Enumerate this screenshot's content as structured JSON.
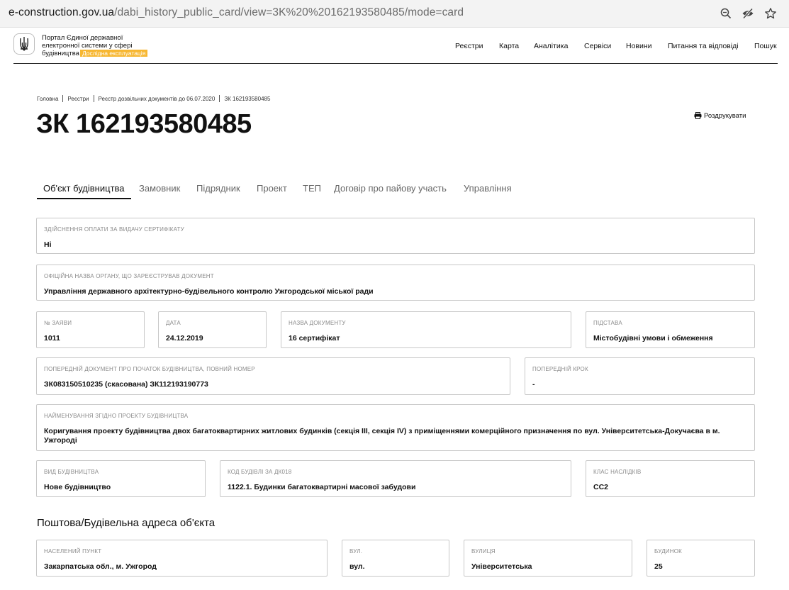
{
  "browser": {
    "url_host": "e-construction.gov.ua",
    "url_path": "/dabi_history_public_card/view=3K%20%20162193580485/mode=card"
  },
  "header": {
    "logo_line1": "Портал Єдиної державної",
    "logo_line2": "електронної системи у сфері",
    "logo_line3": "будівництва",
    "logo_badge": "Дослідна експлуатація",
    "nav": [
      "Реєстри",
      "Карта",
      "Аналітика",
      "Сервіси",
      "Новини",
      "Питання та відповіді",
      "Пошук"
    ]
  },
  "breadcrumb": [
    "Головна",
    "Реєстри",
    "Реєстр дозвільних документів до 06.07.2020",
    "ЗК 162193580485"
  ],
  "page": {
    "title": "ЗК 162193580485",
    "print_label": "Роздрукувати"
  },
  "tabs": [
    "Об'єкт будівництва",
    "Замовник",
    "Підрядник",
    "Проект",
    "ТЕП",
    "Договір про пайову участь",
    "Управління"
  ],
  "fields": {
    "payment": {
      "label": "Здійснення оплати за видачу сертифікату",
      "value": "Ні"
    },
    "authority": {
      "label": "Офіційна назва органу, що зареєстрував документ",
      "value": "Управління державного архітектурно-будівельного контролю Ужгородської міської ради"
    },
    "application_no": {
      "label": "№ заяви",
      "value": "1011"
    },
    "date": {
      "label": "Дата",
      "value": "24.12.2019"
    },
    "doc_name": {
      "label": "Назва документу",
      "value": "16 сертифікат"
    },
    "basis": {
      "label": "Підстава",
      "value": "Містобудівні умови і обмеження"
    },
    "prev_doc": {
      "label": "Попередній документ про початок будівництва, повний номер",
      "value": "ЗК083150510235 (скасована) ЗК112193190773"
    },
    "prev_step": {
      "label": "Попередній крок",
      "value": "-"
    },
    "project_name": {
      "label": "Найменування згідно проекту будівництва",
      "value": "Коригування проекту будівництва двох багатоквартирних житлових будинків (секція ІІІ, секція IV) з приміщеннями комерційного призначення по вул. Університетська-Докучаєва в м. Ужгороді"
    },
    "construction_type": {
      "label": "Вид будівництва",
      "value": "Нове будівництво"
    },
    "building_code": {
      "label": "Код будівлі за ДК018",
      "value": "1122.1. Будинки багатоквартирні масової забудови"
    },
    "consequence_class": {
      "label": "Клас наслідків",
      "value": "СС2"
    }
  },
  "address": {
    "section_title": "Поштова/Будівельна адреса об'єкта",
    "locality": {
      "label": "Населений пункт",
      "value": "Закарпатська обл., м. Ужгород"
    },
    "street_type": {
      "label": "Вул.",
      "value": "вул."
    },
    "street": {
      "label": "Вулиця",
      "value": "Університетська"
    },
    "building": {
      "label": "Будинок",
      "value": "25"
    }
  }
}
